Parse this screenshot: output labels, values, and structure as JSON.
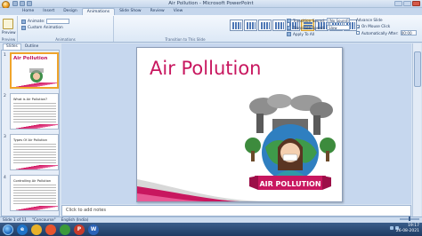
{
  "window": {
    "title": "Air Pollution - Microsoft PowerPoint"
  },
  "tabs": [
    "Home",
    "Insert",
    "Design",
    "Animations",
    "Slide Show",
    "Review",
    "View"
  ],
  "active_tab": "Animations",
  "ribbon": {
    "preview_label": "Preview",
    "animate_label": "Animate:",
    "animate_value": "",
    "custom_animation_label": "Custom Animation",
    "animations_group": "Animations",
    "transition_group": "Transition to This Slide",
    "preview_group": "Preview",
    "transition_sound_label": "Transition Sound:",
    "transition_sound_value": "[No Sound]",
    "transition_speed_label": "Transition Speed:",
    "transition_speed_value": "Slow",
    "apply_all_label": "Apply To All",
    "advance_label": "Advance Slide",
    "on_mouse_click_label": "On Mouse Click",
    "auto_after_label": "Automatically After:",
    "auto_after_value": "00:00"
  },
  "pane_tabs": [
    "Slides",
    "Outline"
  ],
  "slides": [
    {
      "num": "1",
      "title": "Air Pollution",
      "heading": ""
    },
    {
      "num": "2",
      "title": "",
      "heading": "What is Air Pollution?"
    },
    {
      "num": "3",
      "title": "",
      "heading": "Types Of Air Pollution"
    },
    {
      "num": "4",
      "title": "",
      "heading": "Controlling Air Pollution"
    }
  ],
  "main_slide": {
    "title": "Air Pollution",
    "banner_text": "AIR POLLUTION"
  },
  "notes_placeholder": "Click to add notes",
  "status": {
    "slide_info": "Slide 1 of 11",
    "theme": "\"Concourse\"",
    "language": "English (India)"
  },
  "clock": {
    "time": "19:17",
    "date": "26-08-2021"
  },
  "colors": {
    "accent": "#c8175f",
    "ribbon": "#dce8f6"
  }
}
